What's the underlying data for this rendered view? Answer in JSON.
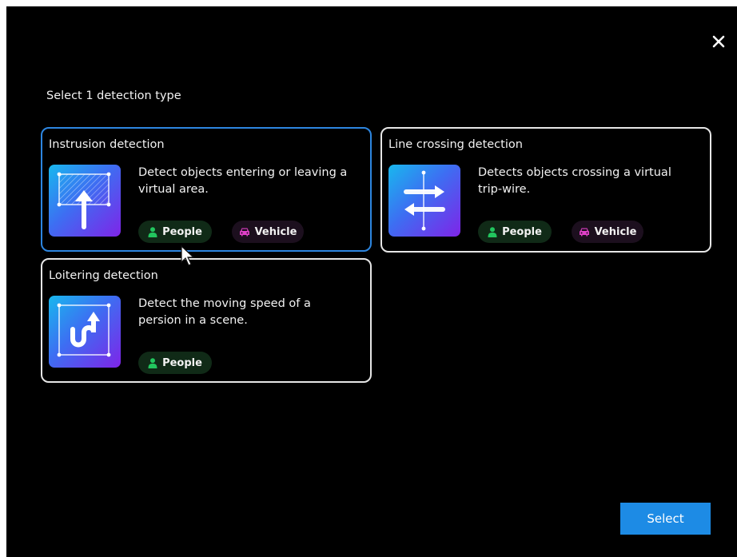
{
  "dialog": {
    "heading": "Select 1 detection type",
    "close_icon": "close-icon",
    "select_label": "Select"
  },
  "cards": [
    {
      "title": "Instrusion detection",
      "description": "Detect objects entering or leaving a virtual area.",
      "icon": "intrusion-area-icon",
      "tags": [
        "People",
        "Vehicle"
      ],
      "selected": true
    },
    {
      "title": "Line crossing detection",
      "description": "Detects objects crossing a virtual trip-wire.",
      "icon": "line-crossing-icon",
      "tags": [
        "People",
        "Vehicle"
      ],
      "selected": false
    },
    {
      "title": "Loitering detection",
      "description": "Detect the moving speed of a persion in a scene.",
      "icon": "loitering-icon",
      "tags": [
        "People"
      ],
      "selected": false
    }
  ],
  "colors": {
    "accent": "#1d8be5",
    "selected_border": "#2d86e0",
    "people": "#22c55e",
    "vehicle": "#e040c8",
    "thumb_gradient": [
      "#18b8ee",
      "#3d6ef2",
      "#7f24e8"
    ]
  }
}
